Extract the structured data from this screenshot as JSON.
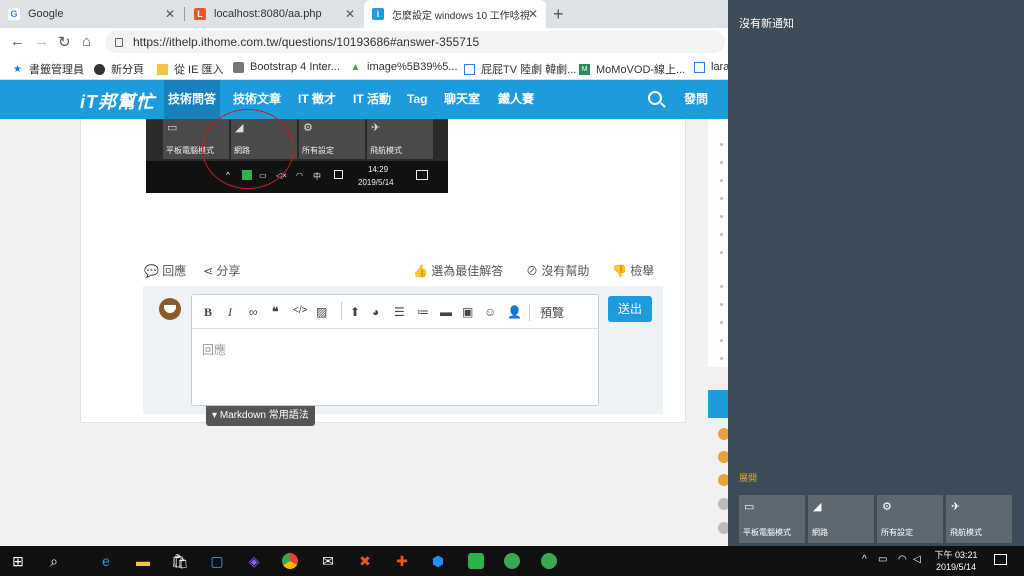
{
  "browser": {
    "tabs": [
      {
        "title": "Google",
        "favicon": "G"
      },
      {
        "title": "localhost:8080/aa.php",
        "favicon": "L"
      },
      {
        "title": "怎麼設定 windows 10 工作唸視",
        "favicon": "i"
      }
    ],
    "url": "https://ithelp.ithome.com.tw/questions/10193686#answer-355715",
    "bookmarks": [
      "書籤管理員",
      "新分頁",
      "從 IE 匯入",
      "Bootstrap 4 Inter...",
      "image%5B39%5...",
      "屁屁TV 陸劇 韓劇...",
      "MoMoVOD-線上...",
      "lara"
    ]
  },
  "site": {
    "logo": "iT邦幫忙",
    "nav": [
      "技術問答",
      "技術文章",
      "IT 徵才",
      "IT 活動",
      "Tag",
      "聊天室",
      "鐵人賽"
    ],
    "post_label": "發問"
  },
  "screenshot": {
    "tiles": [
      "平板電腦模式",
      "網路",
      "所有設定",
      "飛航模式"
    ],
    "tray_ime": "中",
    "time": "14:29",
    "date": "2019/5/14"
  },
  "actions": {
    "reply": "回應",
    "share": "分享",
    "best_answer": "選為最佳解答",
    "no_help": "沒有幫助",
    "report": "檢舉"
  },
  "editor": {
    "preview": "預覽",
    "placeholder": "回應",
    "send": "送出",
    "markdown": "Markdown 常用語法"
  },
  "action_center": {
    "title": "沒有新通知",
    "expand": "展開",
    "tiles": [
      "平板電腦模式",
      "網路",
      "所有設定",
      "飛航模式"
    ]
  },
  "taskbar": {
    "time": "下午 03:21",
    "date": "2019/5/14"
  }
}
